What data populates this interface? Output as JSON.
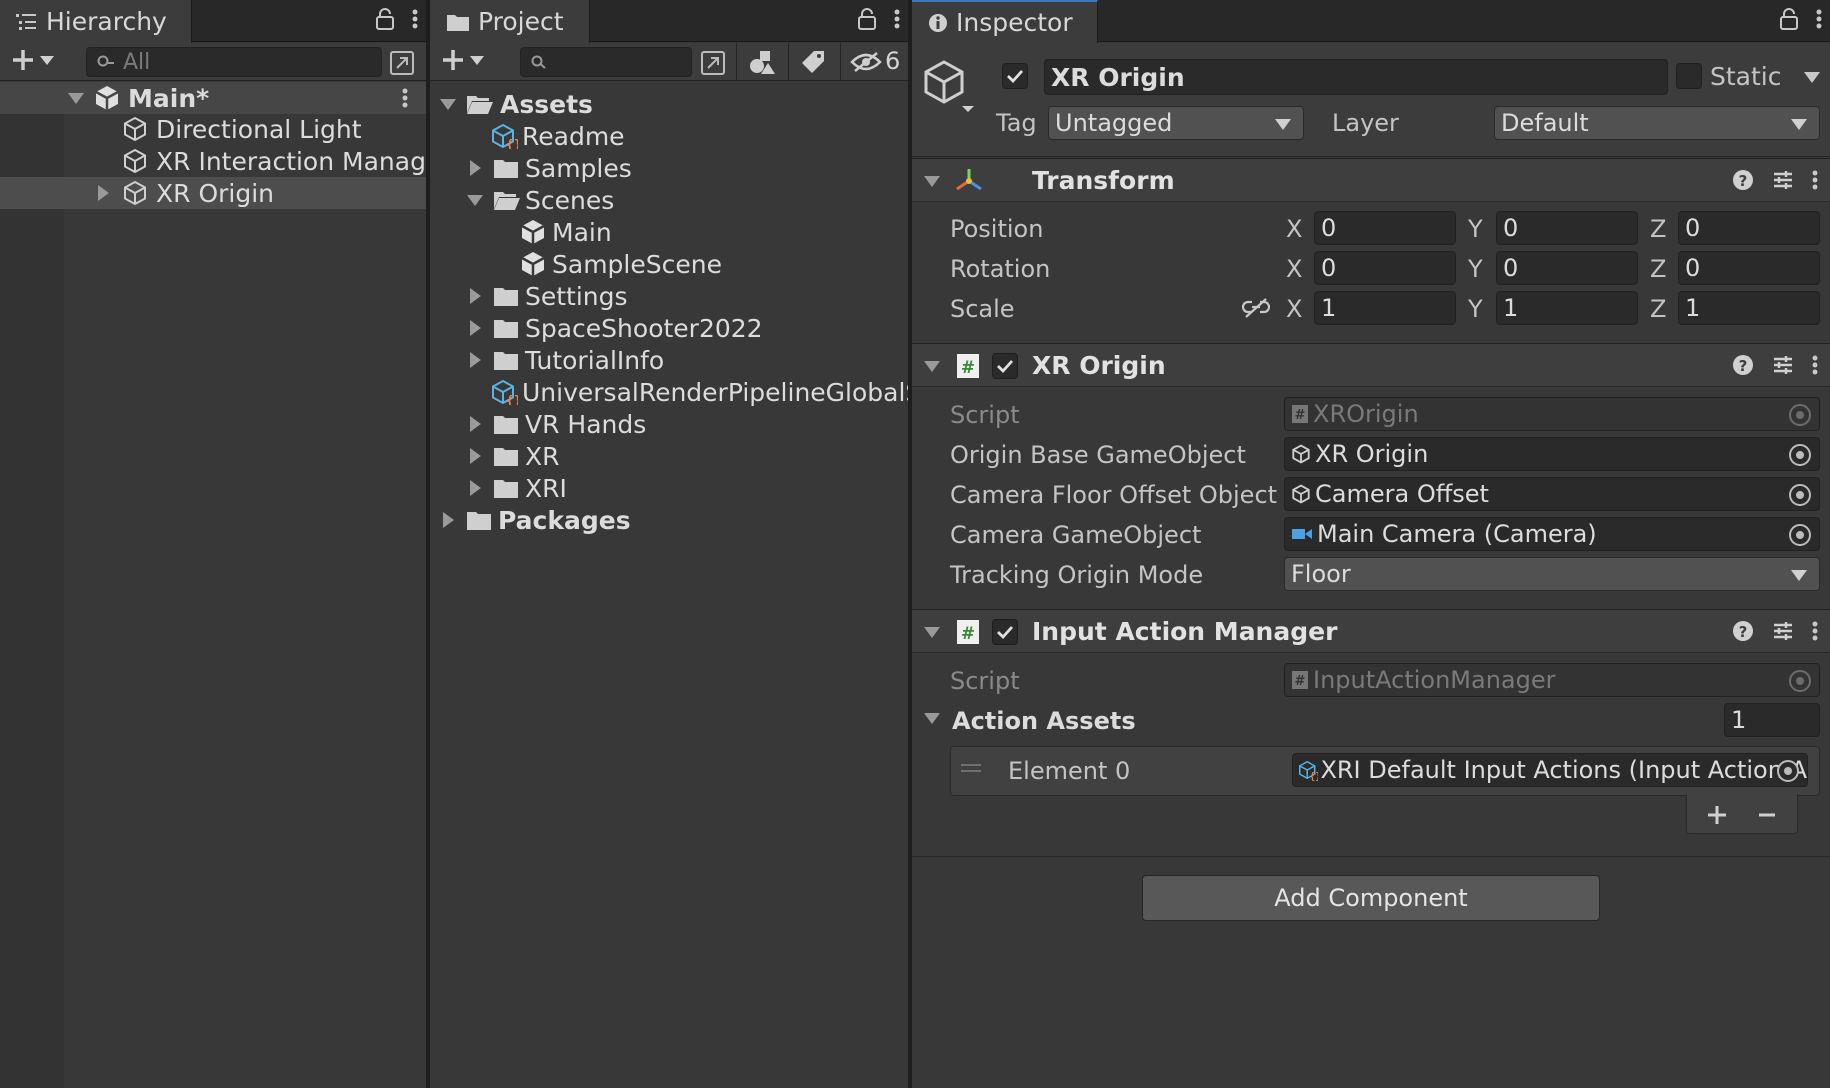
{
  "hierarchy": {
    "tab_label": "Hierarchy",
    "search_placeholder": "All",
    "scene": "Main*",
    "items": [
      "Directional Light",
      "XR Interaction Manager",
      "XR Origin"
    ]
  },
  "project": {
    "tab_label": "Project",
    "hidden_count": "6",
    "tree": {
      "assets": "Assets",
      "readme": "Readme",
      "samples": "Samples",
      "scenes": "Scenes",
      "scene_main": "Main",
      "scene_sample": "SampleScene",
      "settings": "Settings",
      "spaceshooter": "SpaceShooter2022",
      "tutorialinfo": "TutorialInfo",
      "urp": "UniversalRenderPipelineGlobalSe",
      "vrhands": "VR Hands",
      "xr": "XR",
      "xri": "XRI",
      "packages": "Packages"
    }
  },
  "inspector": {
    "tab_label": "Inspector",
    "object_name": "XR Origin",
    "static_label": "Static",
    "tag_label": "Tag",
    "tag_value": "Untagged",
    "layer_label": "Layer",
    "layer_value": "Default",
    "transform": {
      "title": "Transform",
      "position_label": "Position",
      "rotation_label": "Rotation",
      "scale_label": "Scale",
      "axes": [
        "X",
        "Y",
        "Z"
      ],
      "position": [
        "0",
        "0",
        "0"
      ],
      "rotation": [
        "0",
        "0",
        "0"
      ],
      "scale": [
        "1",
        "1",
        "1"
      ]
    },
    "xr_origin": {
      "title": "XR Origin",
      "script_label": "Script",
      "script_value": "XROrigin",
      "origin_base_label": "Origin Base GameObject",
      "origin_base_value": "XR Origin",
      "camera_floor_label": "Camera Floor Offset Object",
      "camera_floor_value": "Camera Offset",
      "camera_go_label": "Camera GameObject",
      "camera_go_value": "Main Camera (Camera)",
      "tracking_label": "Tracking Origin Mode",
      "tracking_value": "Floor"
    },
    "input_action_manager": {
      "title": "Input Action Manager",
      "script_label": "Script",
      "script_value": "InputActionManager",
      "action_assets_label": "Action Assets",
      "action_assets_count": "1",
      "element_label": "Element 0",
      "element_value": "XRI Default Input Actions (Input Action A"
    },
    "add_component": "Add Component"
  }
}
